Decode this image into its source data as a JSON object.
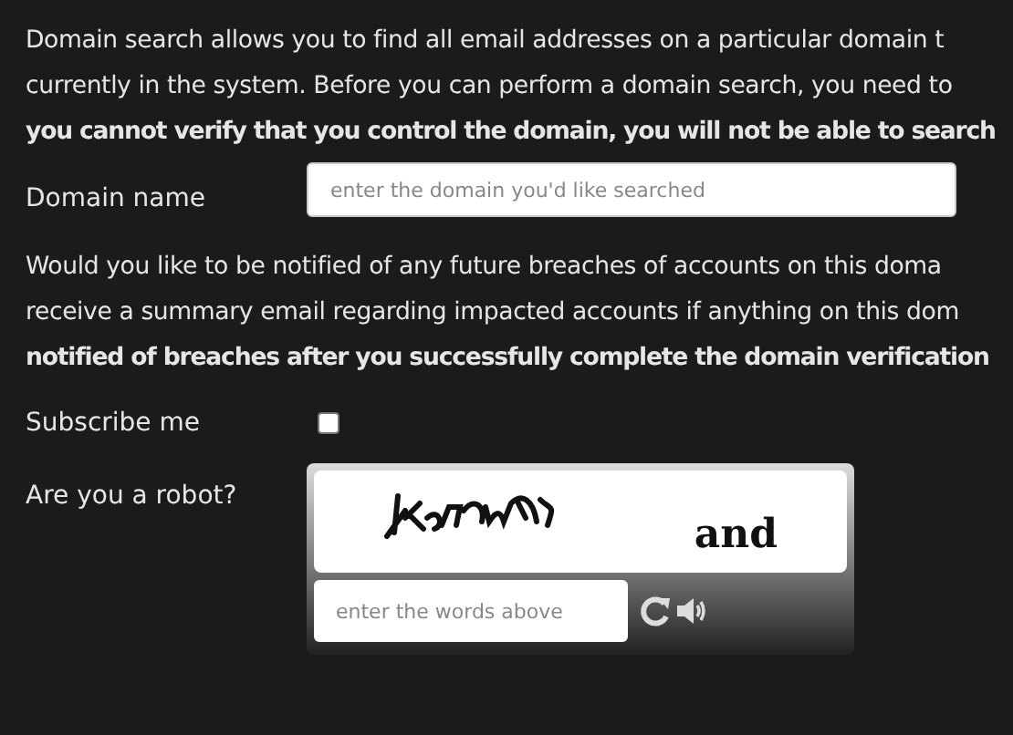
{
  "intro_lines": [
    {
      "text": "Domain search allows you to find all email addresses on a particular domain t",
      "bold": false
    },
    {
      "text": "currently in the system. Before you can perform a domain search, you need to",
      "bold": false
    },
    {
      "text": "you cannot verify that you control the domain, you will not be able to search",
      "bold": true
    }
  ],
  "domain_field": {
    "label": "Domain name",
    "placeholder": "enter the domain you'd like searched"
  },
  "notify_lines": [
    {
      "text": "Would you like to be notified of any future breaches of accounts on this doma",
      "bold": false
    },
    {
      "text": "receive a summary email regarding impacted accounts if anything on this dom",
      "bold": false
    },
    {
      "text": "notified of breaches after you successfully complete the domain verification",
      "bold": true
    }
  ],
  "subscribe": {
    "label": "Subscribe me",
    "checked": false
  },
  "captcha": {
    "label": "Are you a robot?",
    "word": "and",
    "placeholder": "enter the words above"
  }
}
